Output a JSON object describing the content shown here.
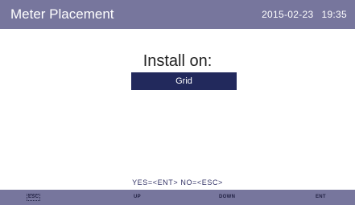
{
  "header": {
    "title": "Meter Placement",
    "date": "2015-02-23",
    "time": "19:35"
  },
  "dialog": {
    "prompt": "Install on:",
    "selected_option": "Grid",
    "hint": "YES=<ENT>  NO=<ESC>"
  },
  "footer": {
    "keys": {
      "esc": "ESC",
      "up": "UP",
      "down": "DOWN",
      "ent": "ENT"
    }
  },
  "colors": {
    "bar": "#77769d",
    "selection": "#22295c"
  }
}
